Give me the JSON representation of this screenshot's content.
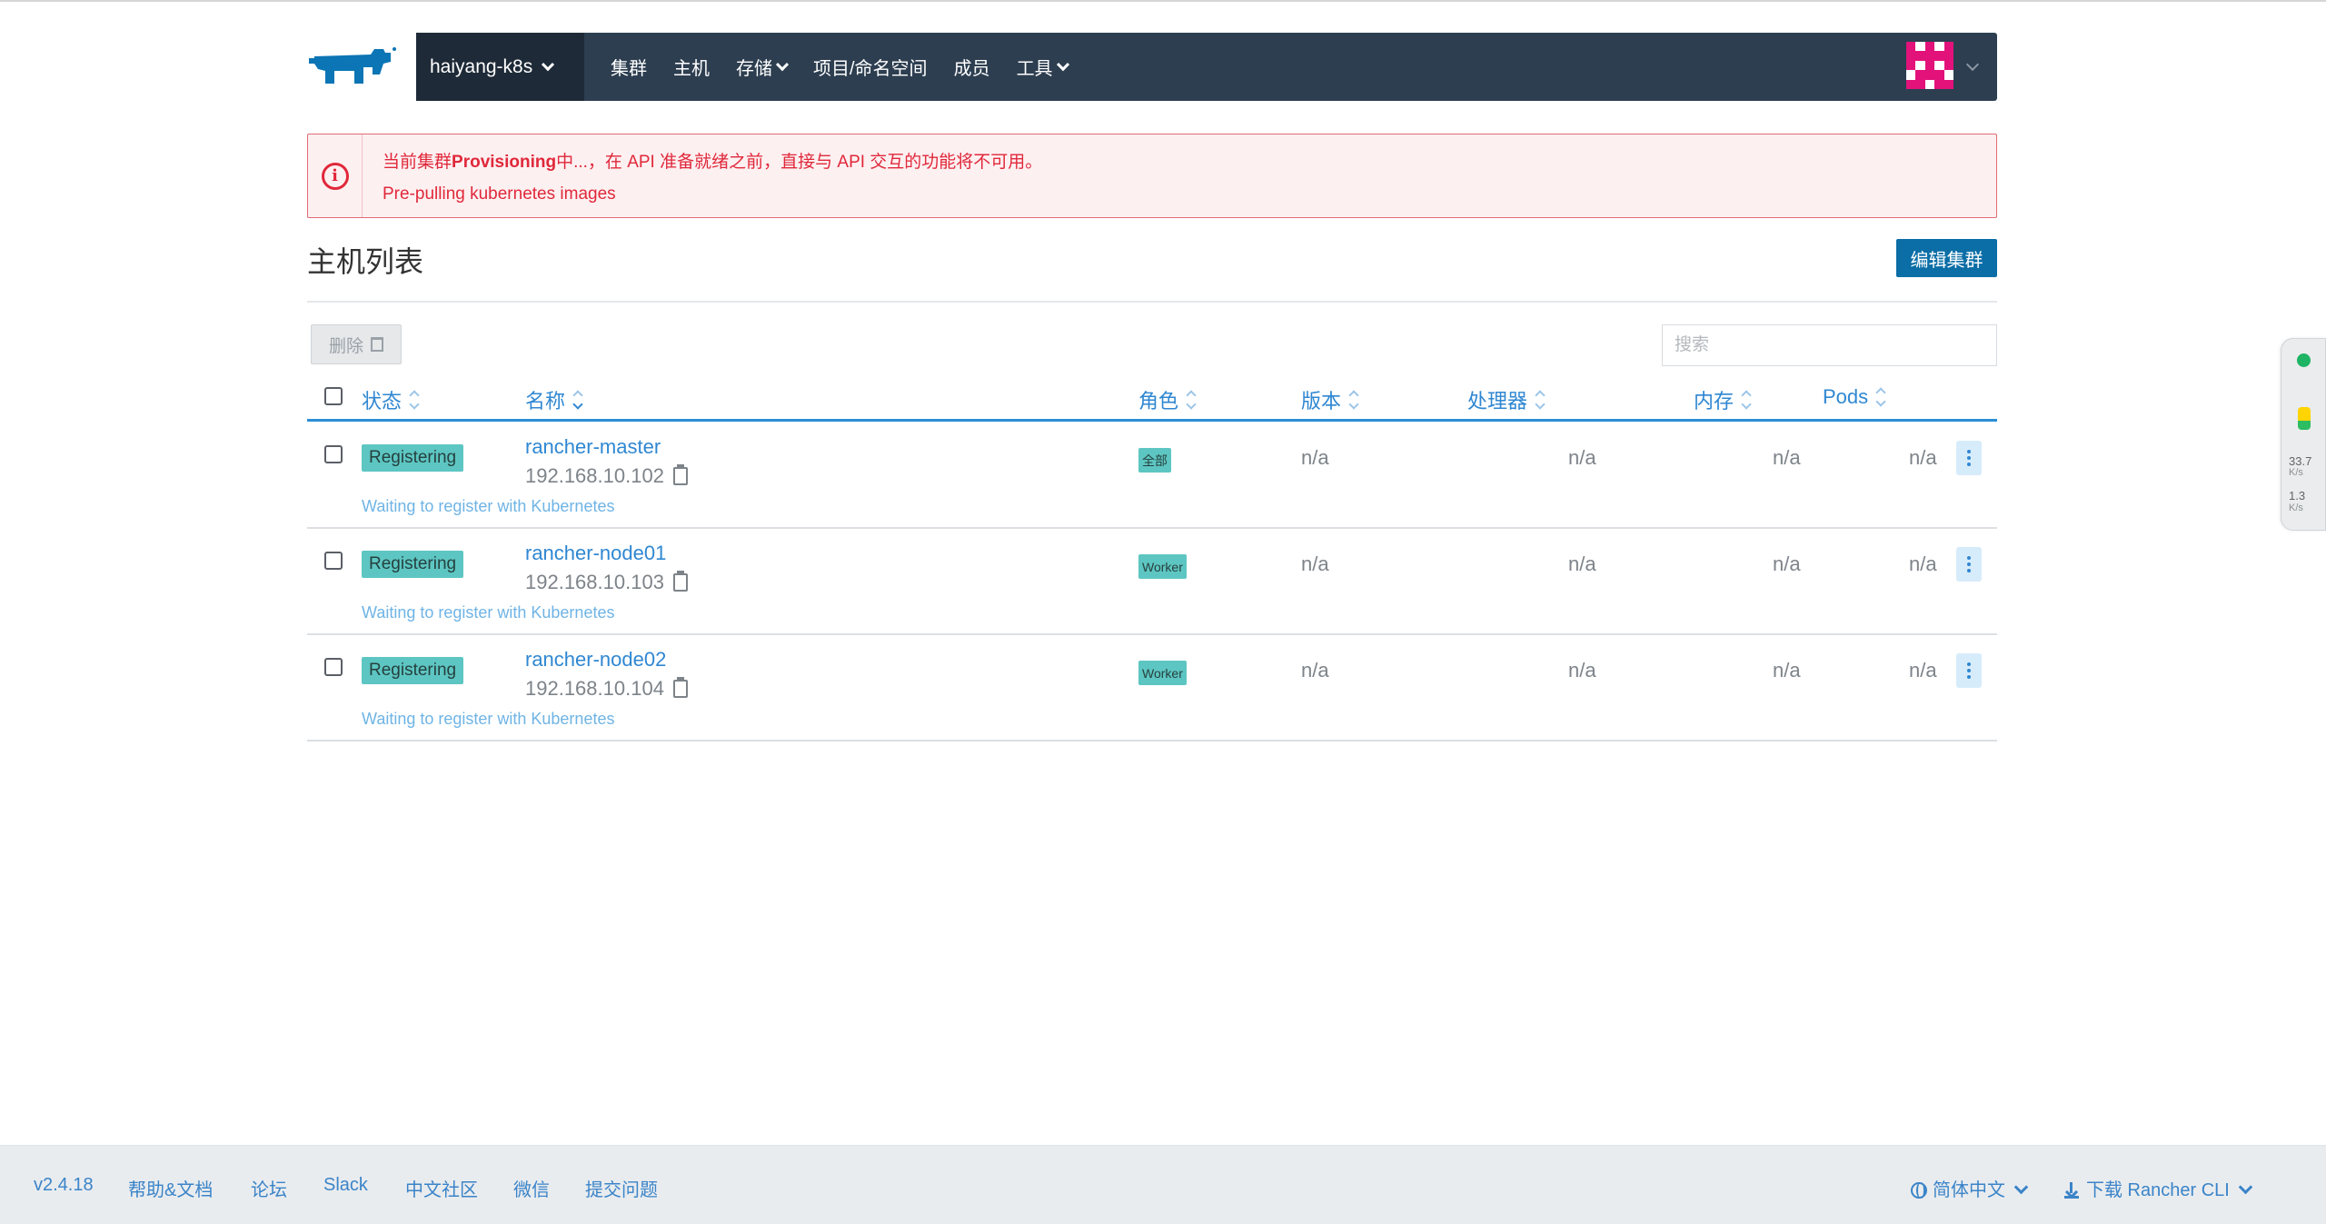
{
  "header": {
    "cluster_name": "haiyang-k8s",
    "nav": [
      {
        "label": "集群"
      },
      {
        "label": "主机"
      },
      {
        "label": "存储"
      },
      {
        "label": "项目/命名空间"
      },
      {
        "label": "成员"
      },
      {
        "label": "工具"
      }
    ]
  },
  "alert": {
    "prefix": "当前集群",
    "state": "Provisioning",
    "suffix": "中...，在 API 准备就绪之前，直接与 API 交互的功能将不可用。",
    "detail": "Pre-pulling kubernetes images"
  },
  "page": {
    "title": "主机列表",
    "edit_button": "编辑集群",
    "delete_button": "删除",
    "search_placeholder": "搜索"
  },
  "table": {
    "columns": {
      "state": "状态",
      "name": "名称",
      "role": "角色",
      "version": "版本",
      "cpu": "处理器",
      "memory": "内存",
      "pods": "Pods"
    },
    "rows": [
      {
        "state": "Registering",
        "name": "rancher-master",
        "ip": "192.168.10.102",
        "message": "Waiting to register with Kubernetes",
        "role": "全部",
        "version": "n/a",
        "cpu": "n/a",
        "memory": "n/a",
        "pods": "n/a"
      },
      {
        "state": "Registering",
        "name": "rancher-node01",
        "ip": "192.168.10.103",
        "message": "Waiting to register with Kubernetes",
        "role": "Worker",
        "version": "n/a",
        "cpu": "n/a",
        "memory": "n/a",
        "pods": "n/a"
      },
      {
        "state": "Registering",
        "name": "rancher-node02",
        "ip": "192.168.10.104",
        "message": "Waiting to register with Kubernetes",
        "role": "Worker",
        "version": "n/a",
        "cpu": "n/a",
        "memory": "n/a",
        "pods": "n/a"
      }
    ]
  },
  "widget": {
    "up_value": "33.7",
    "up_unit": "K/s",
    "down_value": "1.3",
    "down_unit": "K/s"
  },
  "footer": {
    "version": "v2.4.18",
    "links": [
      "帮助&文档",
      "论坛",
      "Slack",
      "中文社区",
      "微信",
      "提交问题"
    ],
    "language": "简体中文",
    "download": "下载 Rancher CLI"
  },
  "colors": {
    "nav_bg": "#2d3e50",
    "accent": "#2f87d2",
    "primary_button": "#0b6ea6",
    "badge": "#5dc6c2",
    "error": "#e0283a"
  }
}
